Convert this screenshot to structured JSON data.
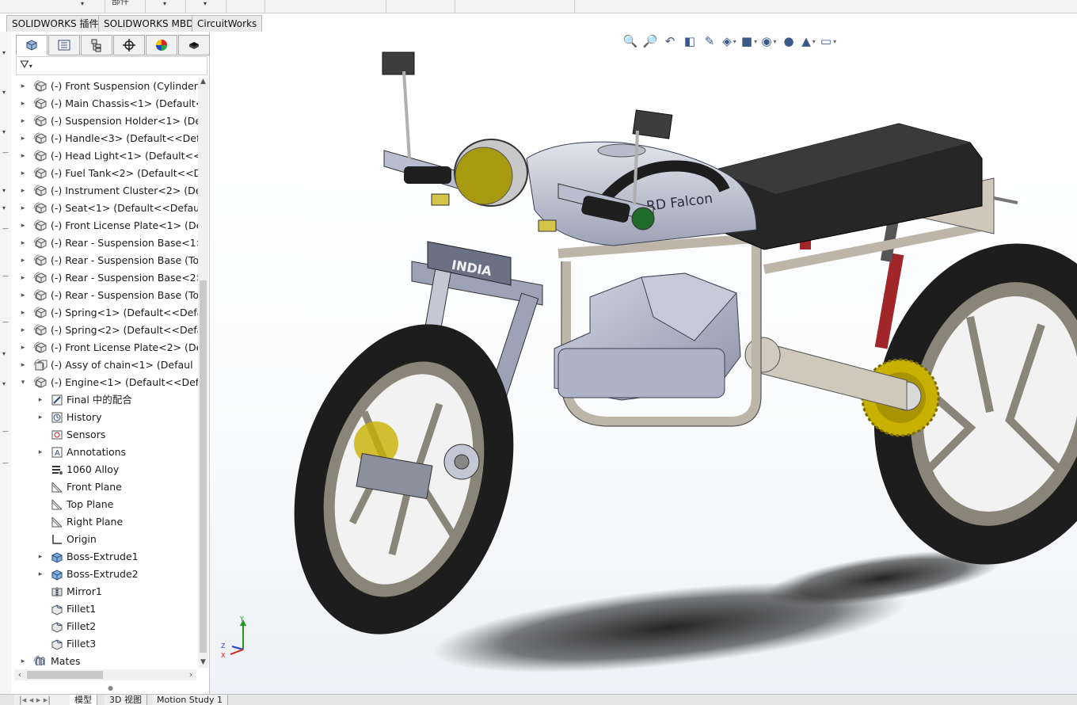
{
  "top_strip": {
    "labels": [
      "部件"
    ]
  },
  "command_tabs": [
    "SOLIDWORKS 插件",
    "SOLIDWORKS MBD",
    "CircuitWorks"
  ],
  "panel_tabs": [
    {
      "icon": "feature-manager-icon"
    },
    {
      "icon": "property-manager-icon"
    },
    {
      "icon": "configuration-manager-icon"
    },
    {
      "icon": "dimxpert-manager-icon"
    },
    {
      "icon": "display-manager-icon"
    },
    {
      "icon": "cam-icon"
    }
  ],
  "tree": [
    {
      "label": "(-) Front Suspension (Cylinder)<",
      "level": 0,
      "expander": "▸",
      "icon": "part-icon"
    },
    {
      "label": "(-) Main Chassis<1> (Default<<",
      "level": 0,
      "expander": "▸",
      "icon": "part-icon"
    },
    {
      "label": "(-) Suspension Holder<1> (Def",
      "level": 0,
      "expander": "▸",
      "icon": "part-icon"
    },
    {
      "label": "(-) Handle<3> (Default<<Defau",
      "level": 0,
      "expander": "▸",
      "icon": "part-icon"
    },
    {
      "label": "(-) Head Light<1> (Default<<D",
      "level": 0,
      "expander": "▸",
      "icon": "part-icon"
    },
    {
      "label": "(-) Fuel Tank<2> (Default<<Def",
      "level": 0,
      "expander": "▸",
      "icon": "part-icon"
    },
    {
      "label": "(-) Instrument Cluster<2> (Defa",
      "level": 0,
      "expander": "▸",
      "icon": "part-icon"
    },
    {
      "label": "(-) Seat<1> (Default<<Default>",
      "level": 0,
      "expander": "▸",
      "icon": "part-icon"
    },
    {
      "label": "(-) Front License Plate<1> (Def",
      "level": 0,
      "expander": "▸",
      "icon": "part-icon"
    },
    {
      "label": "(-) Rear - Suspension Base<1>",
      "level": 0,
      "expander": "▸",
      "icon": "part-icon"
    },
    {
      "label": "(-) Rear - Suspension Base (Top",
      "level": 0,
      "expander": "▸",
      "icon": "part-icon"
    },
    {
      "label": "(-) Rear - Suspension Base<2>",
      "level": 0,
      "expander": "▸",
      "icon": "part-icon"
    },
    {
      "label": "(-) Rear - Suspension Base (Top",
      "level": 0,
      "expander": "▸",
      "icon": "part-icon"
    },
    {
      "label": "(-) Spring<1> (Default<<Defau",
      "level": 0,
      "expander": "▸",
      "icon": "part-icon"
    },
    {
      "label": "(-) Spring<2> (Default<<Defau",
      "level": 0,
      "expander": "▸",
      "icon": "part-icon"
    },
    {
      "label": "(-) Front License Plate<2> (Def",
      "level": 0,
      "expander": "▸",
      "icon": "part-icon"
    },
    {
      "label": "(-) Assy of chain<1> (Defaul",
      "level": 0,
      "expander": "▸",
      "icon": "assembly-icon"
    },
    {
      "label": "(-) Engine<1> (Default<<Defau",
      "level": 0,
      "expander": "▾",
      "icon": "part-icon"
    },
    {
      "label": "Final 中的配合",
      "level": 1,
      "expander": "▸",
      "icon": "mates-folder-icon"
    },
    {
      "label": "History",
      "level": 1,
      "expander": "▸",
      "icon": "history-icon"
    },
    {
      "label": "Sensors",
      "level": 1,
      "expander": "",
      "icon": "sensors-icon"
    },
    {
      "label": "Annotations",
      "level": 1,
      "expander": "▸",
      "icon": "annotations-icon"
    },
    {
      "label": "1060 Alloy",
      "level": 1,
      "expander": "",
      "icon": "material-icon"
    },
    {
      "label": "Front Plane",
      "level": 1,
      "expander": "",
      "icon": "plane-icon"
    },
    {
      "label": "Top Plane",
      "level": 1,
      "expander": "",
      "icon": "plane-icon"
    },
    {
      "label": "Right Plane",
      "level": 1,
      "expander": "",
      "icon": "plane-icon"
    },
    {
      "label": "Origin",
      "level": 1,
      "expander": "",
      "icon": "origin-icon"
    },
    {
      "label": "Boss-Extrude1",
      "level": 1,
      "expander": "▸",
      "icon": "extrude-icon"
    },
    {
      "label": "Boss-Extrude2",
      "level": 1,
      "expander": "▸",
      "icon": "extrude-icon"
    },
    {
      "label": "Mirror1",
      "level": 1,
      "expander": "",
      "icon": "mirror-icon"
    },
    {
      "label": "Fillet1",
      "level": 1,
      "expander": "",
      "icon": "fillet-icon"
    },
    {
      "label": "Fillet2",
      "level": 1,
      "expander": "",
      "icon": "fillet-icon"
    },
    {
      "label": "Fillet3",
      "level": 1,
      "expander": "",
      "icon": "fillet-icon"
    },
    {
      "label": "Mates",
      "level": 0,
      "expander": "▸",
      "icon": "mates-icon"
    }
  ],
  "hud_buttons": [
    {
      "icon": "zoom-to-fit-icon",
      "glyph": "🔍",
      "dropdown": false
    },
    {
      "icon": "zoom-to-area-icon",
      "glyph": "🔎",
      "dropdown": false
    },
    {
      "icon": "previous-view-icon",
      "glyph": "↶",
      "dropdown": false
    },
    {
      "icon": "section-view-icon",
      "glyph": "◧",
      "dropdown": false
    },
    {
      "icon": "dynamic-annotation-icon",
      "glyph": "✎",
      "dropdown": false
    },
    {
      "icon": "view-orientation-icon",
      "glyph": "◈",
      "dropdown": true
    },
    {
      "icon": "display-style-icon",
      "glyph": "■",
      "dropdown": true
    },
    {
      "icon": "hide-show-items-icon",
      "glyph": "◉",
      "dropdown": true
    },
    {
      "icon": "edit-appearance-icon",
      "glyph": "●",
      "dropdown": false
    },
    {
      "icon": "apply-scene-icon",
      "glyph": "▲",
      "dropdown": true
    },
    {
      "icon": "view-settings-icon",
      "glyph": "▭",
      "dropdown": true
    }
  ],
  "model": {
    "license_plate": "INDIA",
    "tank_brand": "RD Falcon",
    "triad_axes": [
      "Y",
      "Z",
      "X"
    ]
  },
  "bottom_tabs": [
    "模型",
    "3D 视图",
    "Motion Study 1"
  ],
  "colors": {
    "frame": "#bdb6a8",
    "tyre": "#1d1d1d",
    "rim": "#8a8579",
    "sprocket": "#c9b100",
    "headlight_lens": "#a89a10",
    "tank": "#c9ccd8",
    "seat": "#262626",
    "engine": "#b9bdd0",
    "spring": "#a0262a"
  }
}
